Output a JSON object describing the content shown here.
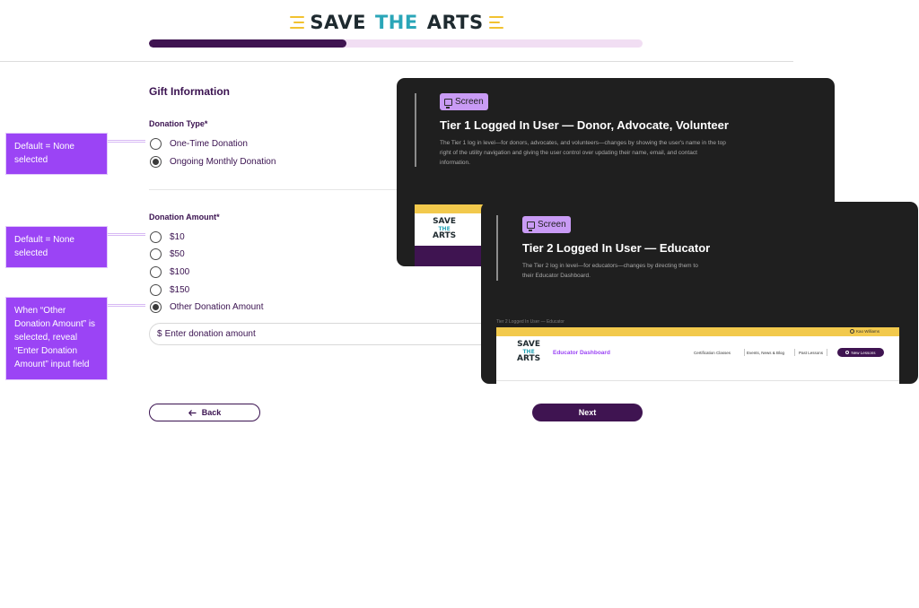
{
  "header": {
    "logo": {
      "word1": "SAVE",
      "word2": "THE",
      "word3": "ARTS"
    },
    "progress_fraction": 0.4
  },
  "form": {
    "section_title": "Gift Information",
    "donation_type": {
      "label": "Donation Type*",
      "options": [
        "One-Time Donation",
        "Ongoing Monthly Donation"
      ],
      "selected_index": 1
    },
    "donation_amount": {
      "label": "Donation Amount*",
      "options": [
        "$10",
        "$50",
        "$100",
        "$150",
        "Other Donation Amount"
      ],
      "selected_index": 4
    },
    "amount_input": {
      "prefix": "$",
      "placeholder": "Enter donation amount"
    },
    "back_label": "Back",
    "next_label": "Next"
  },
  "annotations": {
    "type_default": "Default = None selected",
    "amount_default": "Default = None selected",
    "other_reveal": "When “Other Donation Amount” is selected, reveal “Enter Donation Amount” input field"
  },
  "screens": {
    "tier1": {
      "chip": "Screen",
      "title": "Tier 1 Logged In User — Donor, Advocate, Volunteer",
      "description": "The Tier 1 log in level—for donors, advocates, and volunteers—changes by showing the user's name in the top right of the utility navigation and giving the user control over updating their name, email, and contact information.",
      "logo": {
        "word1": "SAVE",
        "word2": "THE",
        "word3": "ARTS"
      }
    },
    "tier2": {
      "chip": "Screen",
      "title": "Tier 2 Logged In User — Educator",
      "description": "The Tier 2 log in level—for educators—changes by directing them to their Educator Dashboard.",
      "frame_caption": "Tier 2 Logged In User — Educator",
      "user_name": "Kao Williams",
      "logo": {
        "word1": "SAVE",
        "word2": "THE",
        "word3": "ARTS"
      },
      "dashboard_label": "Educator Dashboard",
      "nav": [
        "Certification Classes",
        "Events, News & Blog",
        "Past Lessons"
      ],
      "new_lessons_label": "New Lessons"
    }
  },
  "colors": {
    "brand_purple": "#3f1451",
    "annotation_purple": "#9b44f5",
    "chip_lavender": "#c99bf5",
    "brand_yellow": "#f2c94c",
    "brand_teal": "#2aa6b8",
    "card_dark": "#1f1f1f"
  }
}
